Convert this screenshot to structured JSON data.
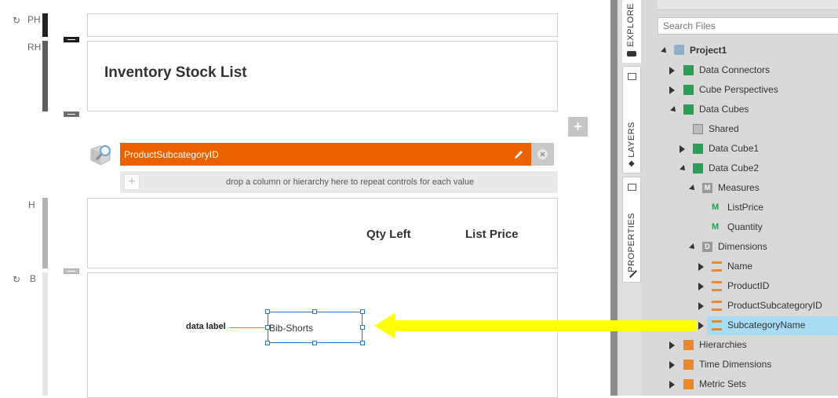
{
  "bands": {
    "ph": "PH",
    "rh": "RH",
    "h": "H",
    "b": "B"
  },
  "report": {
    "title": "Inventory Stock List",
    "group_field": "ProductSubcategoryID",
    "drop_hint": "drop a column or hierarchy here to repeat controls for each value",
    "col_qty": "Qty Left",
    "col_price": "List Price",
    "data_label": "data label",
    "data_value": "Bib-Shorts"
  },
  "sidebar": {
    "tabs": {
      "explore": "EXPLORE",
      "layers": "LAYERS",
      "properties": "PROPERTIES"
    },
    "search_placeholder": "Search Files",
    "tree": {
      "project": "Project1",
      "data_connectors": "Data Connectors",
      "cube_perspectives": "Cube Perspectives",
      "data_cubes": "Data Cubes",
      "shared": "Shared",
      "data_cube1": "Data Cube1",
      "data_cube2": "Data Cube2",
      "measures": "Measures",
      "list_price": "ListPrice",
      "quantity": "Quantity",
      "dimensions": "Dimensions",
      "name": "Name",
      "product_id": "ProductID",
      "product_subcategory_id": "ProductSubcategoryID",
      "subcategory_name": "SubcategoryName",
      "hierarchies": "Hierarchies",
      "time_dimensions": "Time Dimensions",
      "metric_sets": "Metric Sets"
    }
  },
  "colors": {
    "accent_orange": "#ea6200",
    "highlight": "#a8dcf5",
    "arrow": "#ffff00"
  }
}
